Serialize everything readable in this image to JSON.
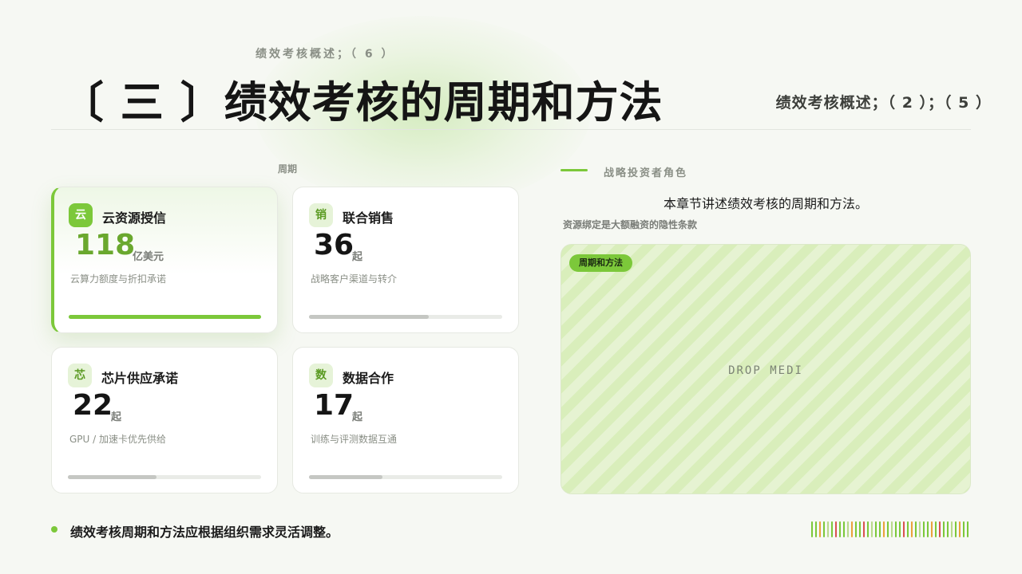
{
  "header": {
    "kicker": "绩效考核概述；（ 6 ）",
    "title": "〔 三 〕绩效考核的周期和方法",
    "right_subtitle": "绩效考核概述；（ 2 ）；（ 5 ）"
  },
  "grid": {
    "label": "周期",
    "cards": [
      {
        "badge": "云",
        "title": "云资源授信",
        "value": "118",
        "unit": "亿美元",
        "desc": "云算力额度与折扣承诺",
        "progress": 1.0,
        "active": true
      },
      {
        "badge": "销",
        "title": "联合销售",
        "value": "36",
        "unit": "起",
        "desc": "战略客户渠道与转介",
        "progress": 0.62,
        "active": false
      },
      {
        "badge": "芯",
        "title": "芯片供应承诺",
        "value": "22",
        "unit": "起",
        "desc": "GPU /  加速卡优先供给",
        "progress": 0.46,
        "active": false
      },
      {
        "badge": "数",
        "title": "数据合作",
        "value": "17",
        "unit": "起",
        "desc": "训练与评测数据互通",
        "progress": 0.38,
        "active": false
      }
    ]
  },
  "section": {
    "label": "战略投资者角色",
    "heading": "本章节讲述绩效考核的周期和方法。",
    "note": "资源绑定是大额融资的隐性条款",
    "media_tag": "周期和方法",
    "media_placeholder": "DROP MEDI"
  },
  "footer": {
    "bullet": "绩效考核周期和方法应根据组织需求灵活调整。"
  },
  "colors": {
    "accent": "#7cc83a",
    "barcode": [
      "#7cc83a",
      "#e9a23b",
      "#d9534f",
      "#b8d98a"
    ]
  }
}
